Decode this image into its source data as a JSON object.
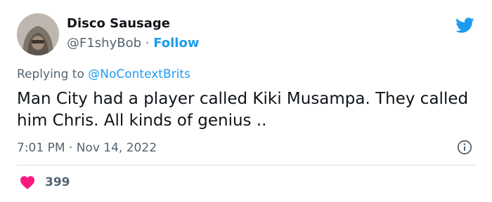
{
  "author": {
    "display_name": "Disco Sausage",
    "handle": "@F1shyBob",
    "separator": " · ",
    "follow_label": "Follow"
  },
  "reply": {
    "prefix": "Replying to ",
    "to_handle": "@NoContextBrits"
  },
  "tweet": {
    "text": "Man City had a player called Kiki Musampa. They called him Chris. All kinds of genius .."
  },
  "meta": {
    "time": "7:01 PM",
    "separator": " · ",
    "date": "Nov 14, 2022"
  },
  "engagement": {
    "likes": "399"
  },
  "colors": {
    "accent": "#1d9bf0",
    "like": "#f91880",
    "secondary_text": "#536471",
    "primary_text": "#0f1419"
  },
  "icons": {
    "brand": "twitter-bird-icon",
    "info": "info-icon",
    "like": "heart-icon"
  }
}
